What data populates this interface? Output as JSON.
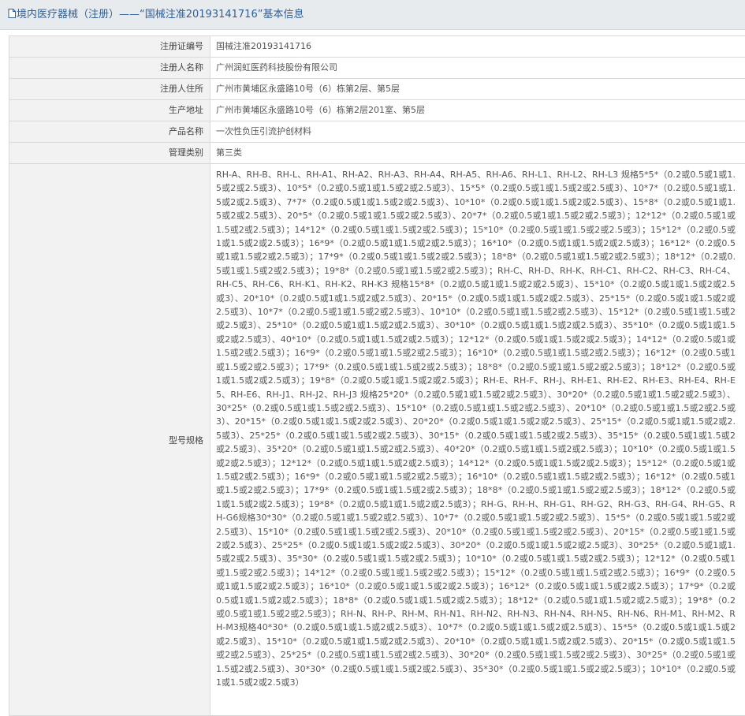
{
  "header": {
    "title": "境内医疗器械（注册）——“国械注准20193141716”基本信息"
  },
  "rows": [
    {
      "label": "注册证编号",
      "value": "国械注准20193141716"
    },
    {
      "label": "注册人名称",
      "value": "广州润虹医药科技股份有限公司"
    },
    {
      "label": "注册人住所",
      "value": "广州市黄埔区永盛路10号（6）栋第2层、第5层"
    },
    {
      "label": "生产地址",
      "value": "广州市黄埔区永盛路10号（6）栋第2层201室、第5层"
    },
    {
      "label": "产品名称",
      "value": "一次性负压引流护创材料"
    },
    {
      "label": "管理类别",
      "value": "第三类"
    }
  ],
  "spec": {
    "label": "型号规格",
    "value": "RH-A、RH-B、RH-L、RH-A1、RH-A2、RH-A3、RH-A4、RH-A5、RH-A6、RH-L1、RH-L2、RH-L3 规格5*5*（0.2或0.5或1或1.5或2或2.5或3）、10*5*（0.2或0.5或1或1.5或2或2.5或3）、15*5*（0.2或0.5或1或1.5或2或2.5或3）、10*7*（0.2或0.5或1或1.5或2或2.5或3）、7*7*（0.2或0.5或1或1.5或2或2.5或3）、10*10*（0.2或0.5或1或1.5或2或2.5或3）、15*8*（0.2或0.5或1或1.5或2或2.5或3）、20*5*（0.2或0.5或1或1.5或2或2.5或3）、20*7*（0.2或0.5或1或1.5或2或2.5或3）；12*12*（0.2或0.5或1或1.5或2或2.5或3）；14*12*（0.2或0.5或1或1.5或2或2.5或3）；15*10*（0.2或0.5或1或1.5或2或2.5或3）；15*12*（0.2或0.5或1或1.5或2或2.5或3）；16*9*（0.2或0.5或1或1.5或2或2.5或3）；16*10*（0.2或0.5或1或1.5或2或2.5或3）；16*12*（0.2或0.5或1或1.5或2或2.5或3）；17*9*（0.2或0.5或1或1.5或2或2.5或3）；18*8*（0.2或0.5或1或1.5或2或2.5或3）；18*12*（0.2或0.5或1或1.5或2或2.5或3）；19*8*（0.2或0.5或1或1.5或2或2.5或3）；RH-C、RH-D、RH-K、RH-C1、RH-C2、RH-C3、RH-C4、RH-C5、RH-C6、RH-K1、RH-K2、RH-K3 规格15*8*（0.2或0.5或1或1.5或2或2.5或3）、15*10*（0.2或0.5或1或1.5或2或2.5或3）、20*10*（0.2或0.5或1或1.5或2或2.5或3）、20*15*（0.2或0.5或1或1.5或2或2.5或3）、25*15*（0.2或0.5或1或1.5或2或2.5或3）、10*7*（0.2或0.5或1或1.5或2或2.5或3）、10*10*（0.2或0.5或1或1.5或2或2.5或3）、15*12*（0.2或0.5或1或1.5或2或2.5或3）、25*10*（0.2或0.5或1或1.5或2或2.5或3）、30*10*（0.2或0.5或1或1.5或2或2.5或3）、35*10*（0.2或0.5或1或1.5或2或2.5或3）、40*10*（0.2或0.5或1或1.5或2或2.5或3）；12*12*（0.2或0.5或1或1.5或2或2.5或3）；14*12*（0.2或0.5或1或1.5或2或2.5或3）；16*9*（0.2或0.5或1或1.5或2或2.5或3）；16*10*（0.2或0.5或1或1.5或2或2.5或3）；16*12*（0.2或0.5或1或1.5或2或2.5或3）；17*9*（0.2或0.5或1或1.5或2或2.5或3）；18*8*（0.2或0.5或1或1.5或2或2.5或3）；18*12*（0.2或0.5或1或1.5或2或2.5或3）；19*8*（0.2或0.5或1或1.5或2或2.5或3）；RH-E、RH-F、RH-J、RH-E1、RH-E2、RH-E3、RH-E4、RH-E5、RH-E6、RH-J1、RH-J2、RH-J3 规格25*20*（0.2或0.5或1或1.5或2或2.5或3）、30*20*（0.2或0.5或1或1.5或2或2.5或3）、30*25*（0.2或0.5或1或1.5或2或2.5或3）、15*10*（0.2或0.5或1或1.5或2或2.5或3）、20*10*（0.2或0.5或1或1.5或2或2.5或3）、20*15*（0.2或0.5或1或1.5或2或2.5或3）、20*20*（0.2或0.5或1或1.5或2或2.5或3）、25*15*（0.2或0.5或1或1.5或2或2.5或3）、25*25*（0.2或0.5或1或1.5或2或2.5或3）、30*15*（0.2或0.5或1或1.5或2或2.5或3）、35*15*（0.2或0.5或1或1.5或2或2.5或3）、35*20*（0.2或0.5或1或1.5或2或2.5或3）、40*20*（0.2或0.5或1或1.5或2或2.5或3）；10*10*（0.2或0.5或1或1.5或2或2.5或3）；12*12*（0.2或0.5或1或1.5或2或2.5或3）；14*12*（0.2或0.5或1或1.5或2或2.5或3）；15*12*（0.2或0.5或1或1.5或2或2.5或3）；16*9*（0.2或0.5或1或1.5或2或2.5或3）；16*10*（0.2或0.5或1或1.5或2或2.5或3）；16*12*（0.2或0.5或1或1.5或2或2.5或3）；17*9*（0.2或0.5或1或1.5或2或2.5或3）；18*8*（0.2或0.5或1或1.5或2或2.5或3）；18*12*（0.2或0.5或1或1.5或2或2.5或3）；19*8*（0.2或0.5或1或1.5或2或2.5或3）；RH-G、RH-H、RH-G1、RH-G2、RH-G3、RH-G4、RH-G5、RH-G6规格30*30*（0.2或0.5或1或1.5或2或2.5或3）、10*7*（0.2或0.5或1或1.5或2或2.5或3）、15*5*（0.2或0.5或1或1.5或2或2.5或3）、15*10*（0.2或0.5或1或1.5或2或2.5或3）、20*10*（0.2或0.5或1或1.5或2或2.5或3）、20*15*（0.2或0.5或1或1.5或2或2.5或3）、25*25*（0.2或0.5或1或1.5或2或2.5或3）、30*20*（0.2或0.5或1或1.5或2或2.5或3）、30*25*（0.2或0.5或1或1.5或2或2.5或3）、35*30*（0.2或0.5或1或1.5或2或2.5或3）；10*10*（0.2或0.5或1或1.5或2或2.5或3）；12*12*（0.2或0.5或1或1.5或2或2.5或3）；14*12*（0.2或0.5或1或1.5或2或2.5或3）；15*12*（0.2或0.5或1或1.5或2或2.5或3）；16*9*（0.2或0.5或1或1.5或2或2.5或3）；16*10*（0.2或0.5或1或1.5或2或2.5或3）；16*12*（0.2或0.5或1或1.5或2或2.5或3）；17*9*（0.2或0.5或1或1.5或2或2.5或3）；18*8*（0.2或0.5或1或1.5或2或2.5或3）；18*12*（0.2或0.5或1或1.5或2或2.5或3）；19*8*（0.2或0.5或1或1.5或2或2.5或3）；RH-N、RH-P、RH-M、RH-N1、RH-N2、RH-N3、RH-N4、RH-N5、RH-N6、RH-M1、RH-M2、RH-M3规格40*30*（0.2或0.5或1或1.5或2或2.5或3）、10*7*（0.2或0.5或1或1.5或2或2.5或3）、15*5*（0.2或0.5或1或1.5或2或2.5或3）、15*10*（0.2或0.5或1或1.5或2或2.5或3）、20*10*（0.2或0.5或1或1.5或2或2.5或3）、20*15*（0.2或0.5或1或1.5或2或2.5或3）、25*25*（0.2或0.5或1或1.5或2或2.5或3）、30*20*（0.2或0.5或1或1.5或2或2.5或3）、30*25*（0.2或0.5或1或1.5或2或2.5或3）、30*30*（0.2或0.5或1或1.5或2或2.5或3）、35*30*（0.2或0.5或1或1.5或2或2.5或3）；10*10*（0.2或0.5或1或1.5或2或2.5或3）"
  }
}
